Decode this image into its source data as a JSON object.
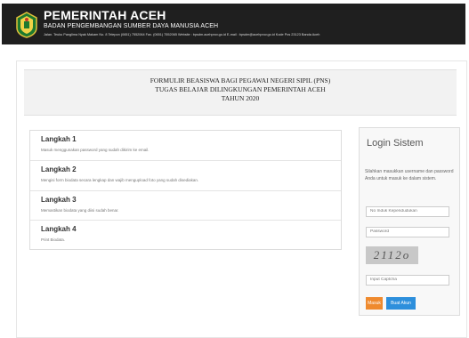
{
  "header": {
    "title": "PEMERINTAH ACEH",
    "subtitle": "BADAN PENGEMBANGAN SUMBER DAYA MANUSIA ACEH",
    "address": "Jalan. Teuku Panglima Nyak Makam No. 8 Telepon (0651) 7552064 Fax. (0651) 7552065 Website : bpsdm.acehprov.go.id E-mail : bpsdm@acehprov.go.id Kode Pos 23123 Banda Aceh",
    "logo_icon": "aceh-emblem-icon"
  },
  "form_title": {
    "line1": "FORMULIR BEASISWA BAGI PEGAWAI NEGERI SIPIL (PNS)",
    "line2": "TUGAS BELAJAR DILINGKUNGAN PEMERINTAH ACEH",
    "line3": "TAHUN 2020"
  },
  "steps": [
    {
      "title": "Langkah 1",
      "desc": "Masuk menggunakan password yang sudah dikirim ke email."
    },
    {
      "title": "Langkah 2",
      "desc": "Mengisi form biodata secara lengkap dan wajib mengupload foto yang sudah disediakan."
    },
    {
      "title": "Langkah 3",
      "desc": "Memastikan biodata yang diisi sudah benar."
    },
    {
      "title": "Langkah 4",
      "desc": "Print Biodata."
    }
  ],
  "login": {
    "title": "Login Sistem",
    "description": "Silahkan masukkan username dan password Anda untuk masuk ke dalam sistem.",
    "nik_placeholder": "No Induk Kependudukan",
    "password_placeholder": "Password",
    "captcha_text": "2112o",
    "captcha_placeholder": "Input Captcha",
    "login_button": "Masuk",
    "register_button": "Buat Akun"
  }
}
